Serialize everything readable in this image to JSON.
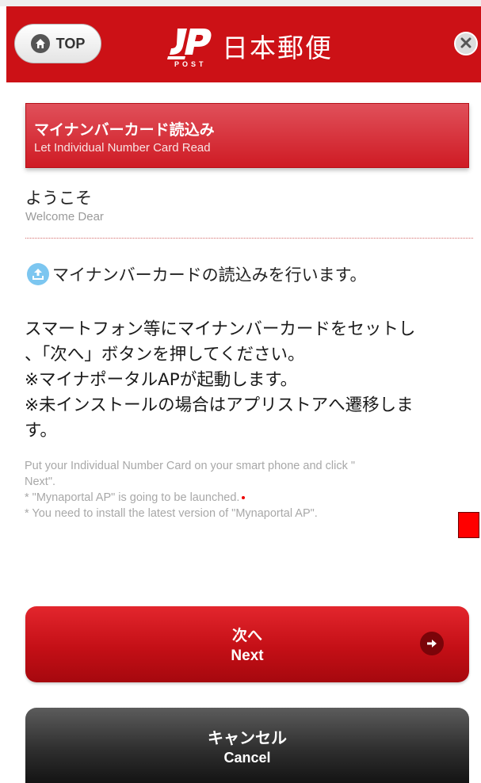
{
  "header": {
    "top_label": "TOP",
    "logo_post_text": "POST",
    "logo_name": "日本郵便",
    "brand_color": "#cc1116",
    "icons": [
      "home-icon",
      "jp-post-logo",
      "close-icon"
    ]
  },
  "section": {
    "title_jp": "マイナンバーカード読込み",
    "title_en": "Let Individual Number Card Read"
  },
  "welcome": {
    "jp": "ようこそ",
    "en": "Welcome Dear"
  },
  "info": {
    "icon": "upload-icon",
    "text": "マイナンバーカードの読込みを行います。"
  },
  "instructions_jp": {
    "line1": "スマートフォン等にマイナンバーカードをセットし",
    "line2": "、「次へ」ボタンを押してください。",
    "line3": "※マイナポータルAPが起動します。",
    "line4": "※未インストールの場合はアプリストアへ遷移しま",
    "line5": "す。"
  },
  "instructions_en": {
    "line1": "Put your Individual Number Card on your smart phone and click \"",
    "line2": "Next\".",
    "line3": "* \"Mynaportal AP\" is going to be launched.",
    "line4": "* You need to install the latest version of \"Mynaportal AP\"."
  },
  "buttons": {
    "next_jp": "次へ",
    "next_en": "Next",
    "next_icon": "arrow-right-icon",
    "cancel_jp": "キャンセル",
    "cancel_en": "Cancel"
  }
}
